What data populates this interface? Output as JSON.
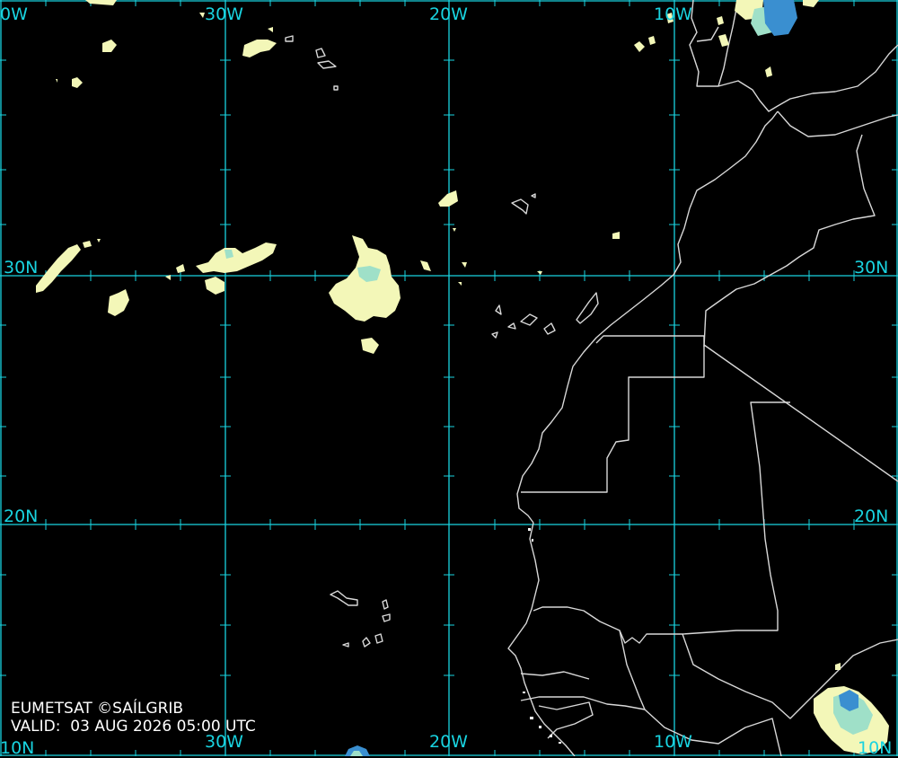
{
  "map": {
    "source": "EUMETSAT ©SAÍLGRIB",
    "valid_label": "VALID:",
    "valid_time": "03 AUG 2026 05:00 UTC",
    "colors": {
      "background": "#000000",
      "graticule": "#19d3e0",
      "coastline": "#d8d8d8",
      "cloud_low": "#f3f7b8",
      "cloud_mid": "#9fe0c8",
      "cloud_high": "#3a8fd0"
    },
    "longitude_labels": {
      "w30": "30W",
      "w20": "20W",
      "w10": "10W",
      "w40_partial": "0W",
      "bottom_w30": "30W",
      "bottom_w20": "20W",
      "bottom_w10": "10W"
    },
    "latitude_labels": {
      "left_30n": "30N",
      "right_30n": "30N",
      "left_20n": "20N",
      "right_20n": "20N",
      "left_10n_partial": "10N",
      "right_10n_partial": "10N"
    }
  }
}
